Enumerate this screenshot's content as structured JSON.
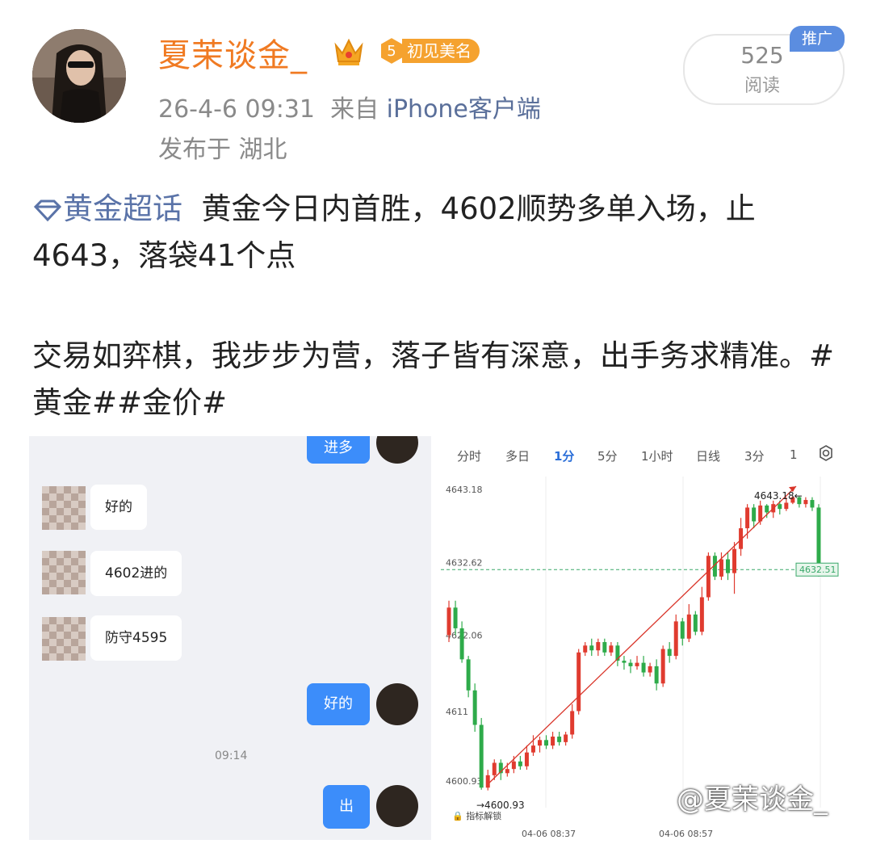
{
  "post": {
    "author": "夏茉谈金_",
    "badge_level": "5",
    "badge_text": "初见美名",
    "time": "26-4-6 09:31",
    "from_prefix": "来自",
    "from_source": "iPhone客户端",
    "location": "发布于 湖北",
    "read_count": "525",
    "read_label": "阅读",
    "promo_label": "推广",
    "topic_link": "黄金超话",
    "text1": "黄金今日内首胜，4602顺势多单入场，止4643，落袋41个点",
    "text2": "交易如弈棋，我步步为营，落子皆有深意，出手务求精准。",
    "tag1": "#黄金#",
    "tag2": "#金价#",
    "watermark": "@夏茉谈金_"
  },
  "chat": {
    "messages": [
      {
        "side": "right",
        "text": "进多"
      },
      {
        "side": "left",
        "text": "好的"
      },
      {
        "side": "left",
        "text": "4602进的"
      },
      {
        "side": "left",
        "text": "防守4595"
      },
      {
        "side": "right",
        "text": "好的"
      },
      {
        "side": "time",
        "text": "09:14"
      },
      {
        "side": "right",
        "text": "出"
      }
    ]
  },
  "chart_ui": {
    "tabs": [
      "分时",
      "多日",
      "1分",
      "5分",
      "1小时",
      "日线",
      "3分",
      "1"
    ],
    "active_tab": "1分",
    "y_labels": [
      "4643.18",
      "4632.62",
      "4622.06",
      "4611",
      "4600.93"
    ],
    "high_label": "4643.18",
    "low_label": "→4600.93",
    "current_price": "4632.51",
    "x_labels": [
      "04-06 08:37",
      "04-06 08:57"
    ],
    "indicator_label": "指标解锁",
    "colors": {
      "up": "#e03b2f",
      "down": "#2eab4a",
      "link": "#5a73a8",
      "accent": "#f07a22"
    }
  },
  "chart_data": {
    "type": "candlestick",
    "ylim": [
      4598,
      4646
    ],
    "y_ticks": [
      4643.18,
      4632.62,
      4622.06,
      4611,
      4600.93
    ],
    "candles": [
      [
        4623.0,
        4627.0,
        4628.0,
        4622.0
      ],
      [
        4627.0,
        4624.0,
        4628.0,
        4623.0
      ],
      [
        4624.0,
        4619.5,
        4625.0,
        4619.0
      ],
      [
        4619.5,
        4615.0,
        4620.0,
        4614.0
      ],
      [
        4615.0,
        4610.0,
        4616.0,
        4609.0
      ],
      [
        4610.0,
        4600.9,
        4611.0,
        4600.6
      ],
      [
        4600.9,
        4602.7,
        4603.5,
        4600.5
      ],
      [
        4602.7,
        4604.5,
        4605.0,
        4602.0
      ],
      [
        4604.5,
        4603.0,
        4605.0,
        4602.0
      ],
      [
        4603.0,
        4603.6,
        4604.5,
        4602.5
      ],
      [
        4603.6,
        4604.7,
        4605.5,
        4603.0
      ],
      [
        4604.7,
        4604.0,
        4605.5,
        4603.5
      ],
      [
        4604.0,
        4606.0,
        4607.0,
        4603.5
      ],
      [
        4606.0,
        4607.0,
        4608.5,
        4605.5
      ],
      [
        4607.0,
        4607.8,
        4608.3,
        4606.0
      ],
      [
        4607.8,
        4607.0,
        4608.5,
        4606.5
      ],
      [
        4607.0,
        4608.3,
        4609.0,
        4606.5
      ],
      [
        4608.3,
        4607.5,
        4609.0,
        4607.0
      ],
      [
        4607.5,
        4608.6,
        4609.0,
        4607.0
      ],
      [
        4608.6,
        4612.0,
        4613.0,
        4608.0
      ],
      [
        4612.0,
        4620.5,
        4621.0,
        4611.5
      ],
      [
        4620.5,
        4621.5,
        4622.0,
        4620.0
      ],
      [
        4621.5,
        4620.8,
        4622.5,
        4620.0
      ],
      [
        4620.8,
        4622.0,
        4622.5,
        4620.0
      ],
      [
        4622.0,
        4620.5,
        4622.5,
        4620.0
      ],
      [
        4620.5,
        4621.5,
        4622.0,
        4620.0
      ],
      [
        4621.5,
        4619.3,
        4622.0,
        4618.5
      ],
      [
        4619.3,
        4619.0,
        4620.0,
        4618.0
      ],
      [
        4619.0,
        4618.5,
        4619.5,
        4617.5
      ],
      [
        4618.5,
        4619.0,
        4620.0,
        4618.0
      ],
      [
        4619.0,
        4617.6,
        4620.0,
        4617.0
      ],
      [
        4617.6,
        4618.5,
        4619.0,
        4617.0
      ],
      [
        4618.5,
        4616.0,
        4619.5,
        4615.0
      ],
      [
        4616.0,
        4621.0,
        4621.5,
        4615.5
      ],
      [
        4621.0,
        4620.0,
        4622.0,
        4619.0
      ],
      [
        4620.0,
        4625.0,
        4626.0,
        4619.5
      ],
      [
        4625.0,
        4622.5,
        4625.5,
        4621.5
      ],
      [
        4622.5,
        4626.0,
        4627.5,
        4622.0
      ],
      [
        4626.0,
        4623.5,
        4626.5,
        4623.0
      ],
      [
        4623.5,
        4628.5,
        4630.0,
        4623.0
      ],
      [
        4628.5,
        4634.5,
        4635.0,
        4628.0
      ],
      [
        4634.5,
        4631.5,
        4635.0,
        4631.0
      ],
      [
        4631.5,
        4634.0,
        4635.0,
        4631.0
      ],
      [
        4634.0,
        4632.0,
        4635.0,
        4631.0
      ],
      [
        4632.0,
        4635.5,
        4636.5,
        4629.0
      ],
      [
        4635.5,
        4638.5,
        4640.0,
        4634.5
      ],
      [
        4638.5,
        4641.5,
        4642.0,
        4637.0
      ],
      [
        4641.5,
        4639.5,
        4642.0,
        4638.5
      ],
      [
        4639.5,
        4641.8,
        4642.5,
        4639.0
      ],
      [
        4641.8,
        4640.8,
        4642.0,
        4640.0
      ],
      [
        4640.8,
        4642.0,
        4642.5,
        4640.0
      ],
      [
        4642.0,
        4641.3,
        4642.5,
        4640.5
      ],
      [
        4641.3,
        4642.2,
        4643.0,
        4641.0
      ],
      [
        4642.2,
        4643.0,
        4643.18,
        4642.0
      ],
      [
        4643.0,
        4642.0,
        4643.1,
        4641.5
      ],
      [
        4642.0,
        4642.6,
        4643.0,
        4641.5
      ],
      [
        4642.6,
        4641.5,
        4643.0,
        4641.0
      ],
      [
        4641.5,
        4632.5,
        4642.0,
        4631.5
      ]
    ],
    "current": 4632.51,
    "high": 4643.18,
    "low": 4600.93
  }
}
